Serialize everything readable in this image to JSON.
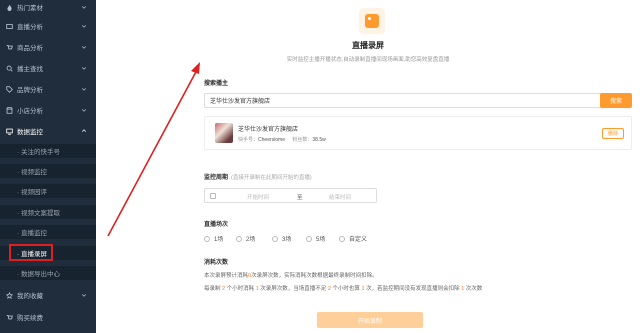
{
  "sidebar": {
    "items": [
      {
        "label": "热门素材",
        "icon": "fire-icon"
      },
      {
        "label": "直播分析",
        "icon": "tv-icon"
      },
      {
        "label": "商品分析",
        "icon": "cart-icon"
      },
      {
        "label": "播主查找",
        "icon": "search-icon"
      },
      {
        "label": "品牌分析",
        "icon": "tag-icon"
      },
      {
        "label": "小店分析",
        "icon": "shop-icon"
      },
      {
        "label": "数据监控",
        "icon": "monitor-icon"
      }
    ],
    "sub_items": [
      {
        "label": "· 关注的快手号"
      },
      {
        "label": "· 视频监控"
      },
      {
        "label": "· 视频园评"
      },
      {
        "label": "· 视频文案提取"
      },
      {
        "label": "· 直播监控"
      },
      {
        "label": "· 直播录屏"
      },
      {
        "label": "· 数据导出中心"
      }
    ],
    "bottom_items": [
      {
        "label": "我的收藏",
        "icon": "star-icon"
      },
      {
        "label": "购买续费",
        "icon": "cart-icon"
      }
    ]
  },
  "main": {
    "title": "直播录屏",
    "subtitle": "实时监控主播开播状态,自动录制直播间现场画面,助您高效复盘直播",
    "search_section_label": "搜索播主",
    "search_input_value": "芝华仕沙发官方旗舰店",
    "search_button": "搜索",
    "result": {
      "name": "芝华仕沙发官方旗舰店",
      "meta_prefix": "快手号：",
      "account": "Cheersiome",
      "fans_prefix": "粉丝数：",
      "fans": "38.5w",
      "delete_button": "删除"
    },
    "period_label": "监控周期",
    "period_hint": "(直接开录制在此期间开始的直播)",
    "start_placeholder": "开始时间",
    "separator": "至",
    "end_placeholder": "结束时间",
    "sessions_label": "直播场次",
    "session_options": [
      "1场",
      "2场",
      "3场",
      "5场",
      "自定义"
    ],
    "consume_label": "消耗次数",
    "consume_line1_a": "本次录屏预计消耗",
    "consume_line1_n": "0",
    "consume_line1_b": "次录屏次数，实际消耗次数根据最终录制时间扣除。",
    "consume_line2_a": "每录制",
    "consume_line2_n1": "2",
    "consume_line2_b": "个小时消耗",
    "consume_line2_n2": "1",
    "consume_line2_c": "次录屏次数，当场直播不足",
    "consume_line2_n3": "2",
    "consume_line2_d": "个小时也算",
    "consume_line2_n4": "1",
    "consume_line2_e": "次，若监控期间没有发现直播则会扣除",
    "consume_line2_n5": "1",
    "consume_line2_f": "次次数",
    "submit_button": "开始录制"
  },
  "colors": {
    "accent": "#ff9a2e",
    "sidebar_bg": "#1f2d3d",
    "annotation_red": "#e02020"
  }
}
